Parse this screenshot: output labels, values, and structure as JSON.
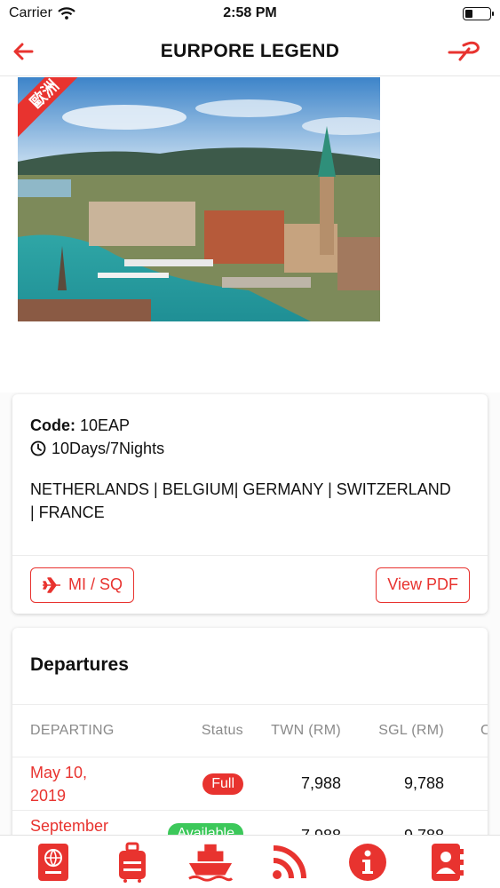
{
  "status_bar": {
    "carrier": "Carrier",
    "time": "2:58 PM",
    "battery_level": 0.3
  },
  "nav": {
    "title": "EURPORE LEGEND",
    "back_icon": "arrow-left-icon",
    "right_icon": "airline-logo-icon"
  },
  "hero": {
    "ribbon_text": "歐洲",
    "image": "zurich-city-photo"
  },
  "tour": {
    "code_label": "Code:",
    "code_value": "10EAP",
    "duration": "10Days/7Nights",
    "countries_line1": "NETHERLANDS | BELGIUM| GERMANY | SWITZERLAND",
    "countries_line2": "| FRANCE",
    "airline_button": "MI / SQ",
    "pdf_button": "View PDF"
  },
  "departures": {
    "title": "Departures",
    "columns": [
      "DEPARTING",
      "Status",
      "TWN (RM)",
      "SGL (RM)",
      "C"
    ],
    "rows": [
      {
        "date_line1": "May 10,",
        "date_line2": "2019",
        "status": "Full",
        "twn": "7,988",
        "sgl": "9,788"
      },
      {
        "date_line1": "September",
        "date_line2": "",
        "status": "Available",
        "twn": "7,988",
        "sgl": "9,788"
      }
    ]
  },
  "tab_bar": {
    "tabs": [
      {
        "icon": "passport-icon"
      },
      {
        "icon": "luggage-icon"
      },
      {
        "icon": "cruise-ship-icon"
      },
      {
        "icon": "rss-feed-icon"
      },
      {
        "icon": "info-icon"
      },
      {
        "icon": "contacts-book-icon"
      }
    ]
  },
  "colors": {
    "accent": "#e8332f",
    "available": "#3cc85a"
  }
}
